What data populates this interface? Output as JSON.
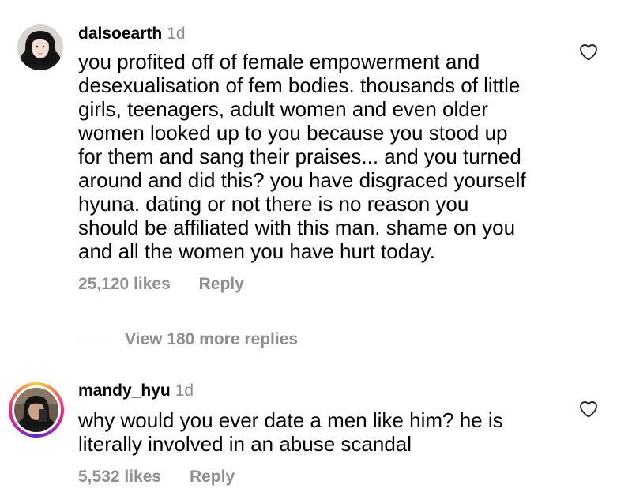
{
  "comments": [
    {
      "username": "dalsoearth",
      "time": "1d",
      "lines": [
        "you profited off of female empowerment and",
        "desexualisation of fem bodies. thousands of little",
        "girls, teenagers, adult women and even older",
        "women looked up to you because you stood up",
        "for them and sang their praises... and you turned",
        "around and did this? you have disgraced yourself",
        "hyuna. dating or not there is no reason you",
        "should be affiliated with this man. shame on you",
        "and all the women you have hurt today."
      ],
      "likes": "25,120 likes",
      "reply_label": "Reply",
      "like_icon": "heart-outline-icon"
    },
    {
      "username": "mandy_hyu",
      "time": "1d",
      "lines": [
        "why would you ever date a men like him? he is",
        "literally involved in an abuse scandal"
      ],
      "likes": "5,532 likes",
      "reply_label": "Reply",
      "like_icon": "heart-outline-icon"
    }
  ],
  "view_replies_label": "View 180 more replies",
  "colors": {
    "text": "#000000",
    "secondary": "#8e8e8e",
    "divider": "#c7c7c7",
    "story_ring": [
      "#f9ce34",
      "#ee2a7b",
      "#6228d7"
    ]
  }
}
